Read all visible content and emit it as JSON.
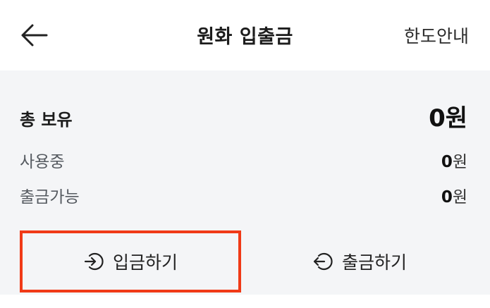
{
  "header": {
    "title": "원화 입출금",
    "limit_link": "한도안내",
    "back_icon": "arrow-left-icon"
  },
  "balance": {
    "total_label": "총 보유",
    "total_value": "0원",
    "in_use_label": "사용중",
    "in_use_amount": "0",
    "in_use_unit": "원",
    "withdrawable_label": "출금가능",
    "withdrawable_amount": "0",
    "withdrawable_unit": "원"
  },
  "actions": {
    "deposit_label": "입금하기",
    "deposit_icon": "deposit-circular-arrow-icon",
    "withdraw_label": "출금하기",
    "withdraw_icon": "withdraw-circular-arrow-icon"
  },
  "colors": {
    "highlight": "#f03a17",
    "panel_bg": "#f4f5f7"
  }
}
